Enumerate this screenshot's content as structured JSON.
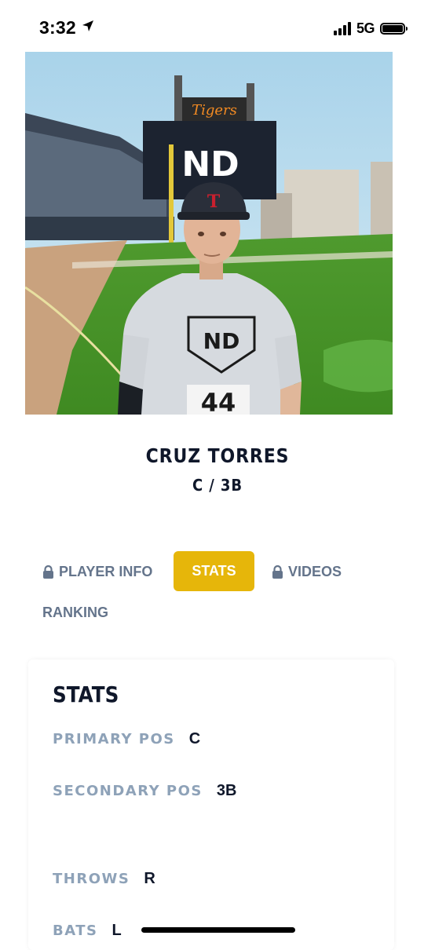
{
  "status_bar": {
    "time": "3:32",
    "network": "5G",
    "location_icon": "location-arrow-icon",
    "signal_icon": "signal-bars-icon",
    "battery_icon": "battery-icon"
  },
  "player": {
    "name": "CRUZ TORRES",
    "positions": "C / 3B",
    "photo": {
      "jersey_number": "44",
      "shirt_logo": "ND",
      "cap_logo": "T",
      "scoreboard_logo": "ND",
      "stadium_sign": "Tigers"
    }
  },
  "tabs": [
    {
      "label": "PLAYER INFO",
      "locked": true,
      "active": false
    },
    {
      "label": "STATS",
      "locked": false,
      "active": true
    },
    {
      "label": "VIDEOS",
      "locked": true,
      "active": false
    },
    {
      "label": "RANKING",
      "locked": false,
      "active": false
    }
  ],
  "stats": {
    "title": "STATS",
    "rows": [
      {
        "label": "PRIMARY POS",
        "value": "C"
      },
      {
        "label": "SECONDARY POS",
        "value": "3B"
      },
      {
        "label": "THROWS",
        "value": "R"
      },
      {
        "label": "BATS",
        "value": "L"
      }
    ]
  },
  "colors": {
    "accent": "#e6b60a",
    "heading": "#0f172a",
    "tab_text": "#64748b",
    "stat_label": "#8ea2b8"
  }
}
